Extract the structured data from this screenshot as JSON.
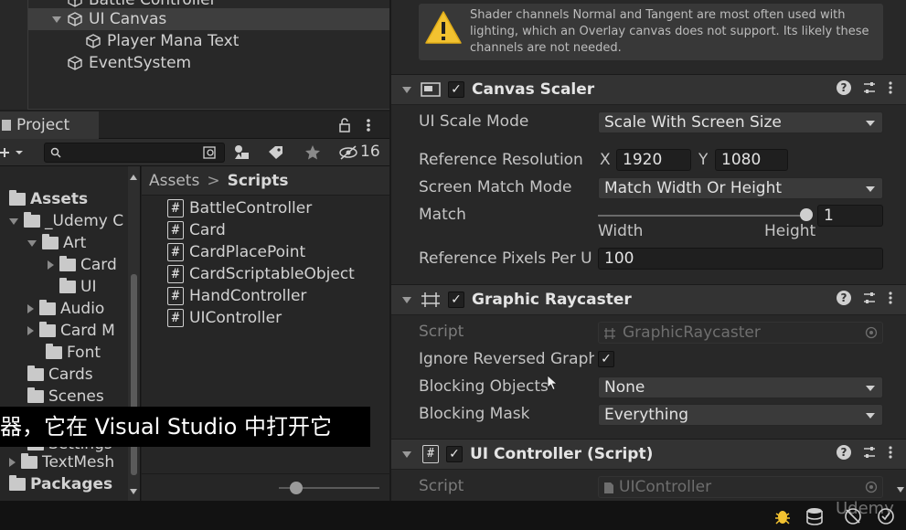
{
  "hierarchy": {
    "items": [
      {
        "label": "Battle Controller"
      },
      {
        "label": "UI Canvas"
      },
      {
        "label": "Player Mana Text"
      },
      {
        "label": "EventSystem"
      }
    ]
  },
  "project": {
    "tab_label": "Project",
    "toolbar": {
      "hidden_count": "16",
      "search_placeholder": ""
    },
    "breadcrumb": {
      "root": "Assets",
      "separator": ">",
      "current": "Scripts"
    },
    "tree": [
      {
        "label": "Assets"
      },
      {
        "label": "_Udemy C"
      },
      {
        "label": "Art"
      },
      {
        "label": "Card"
      },
      {
        "label": "UI"
      },
      {
        "label": "Audio"
      },
      {
        "label": "Card M"
      },
      {
        "label": "Font"
      },
      {
        "label": "Cards"
      },
      {
        "label": "Scenes"
      },
      {
        "label": "Settings"
      },
      {
        "label": "TextMesh"
      },
      {
        "label": "Packages"
      }
    ],
    "files": [
      {
        "label": "BattleController"
      },
      {
        "label": "Card"
      },
      {
        "label": "CardPlacePoint"
      },
      {
        "label": "CardScriptableObject"
      },
      {
        "label": "HandController"
      },
      {
        "label": "UIController"
      }
    ]
  },
  "inspector": {
    "warning": {
      "text": "Shader channels Normal and Tangent are most often used with lighting, which an Overlay canvas does not support. Its likely these channels are not needed."
    },
    "canvas_scaler": {
      "title": "Canvas Scaler",
      "ui_scale_mode_label": "UI Scale Mode",
      "ui_scale_mode_value": "Scale With Screen Size",
      "ref_res_label": "Reference Resolution",
      "x_label": "X",
      "x_value": "1920",
      "y_label": "Y",
      "y_value": "1080",
      "match_mode_label": "Screen Match Mode",
      "match_mode_value": "Match Width Or Height",
      "match_label": "Match",
      "match_value": "1",
      "match_fraction": 1.0,
      "width_label": "Width",
      "height_label": "Height",
      "ref_pixels_label": "Reference Pixels Per U",
      "ref_pixels_value": "100"
    },
    "graphic_raycaster": {
      "title": "Graphic Raycaster",
      "script_label": "Script",
      "script_value": "GraphicRaycaster",
      "ignore_reversed_label": "Ignore Reversed Graphi",
      "ignore_reversed_checked": true,
      "blocking_objects_label": "Blocking Objects",
      "blocking_objects_value": "None",
      "blocking_mask_label": "Blocking Mask",
      "blocking_mask_value": "Everything"
    },
    "ui_controller": {
      "title": "UI Controller (Script)",
      "script_label": "Script",
      "script_value": "UIController"
    }
  },
  "subtitle": {
    "text": "器，它在 Visual Studio 中打开它"
  },
  "taskbar": {
    "watermark": "Udemy"
  },
  "colors": {
    "accent_warning": "#f2c230",
    "panel_bg": "#282828",
    "header_bg": "#333333"
  }
}
